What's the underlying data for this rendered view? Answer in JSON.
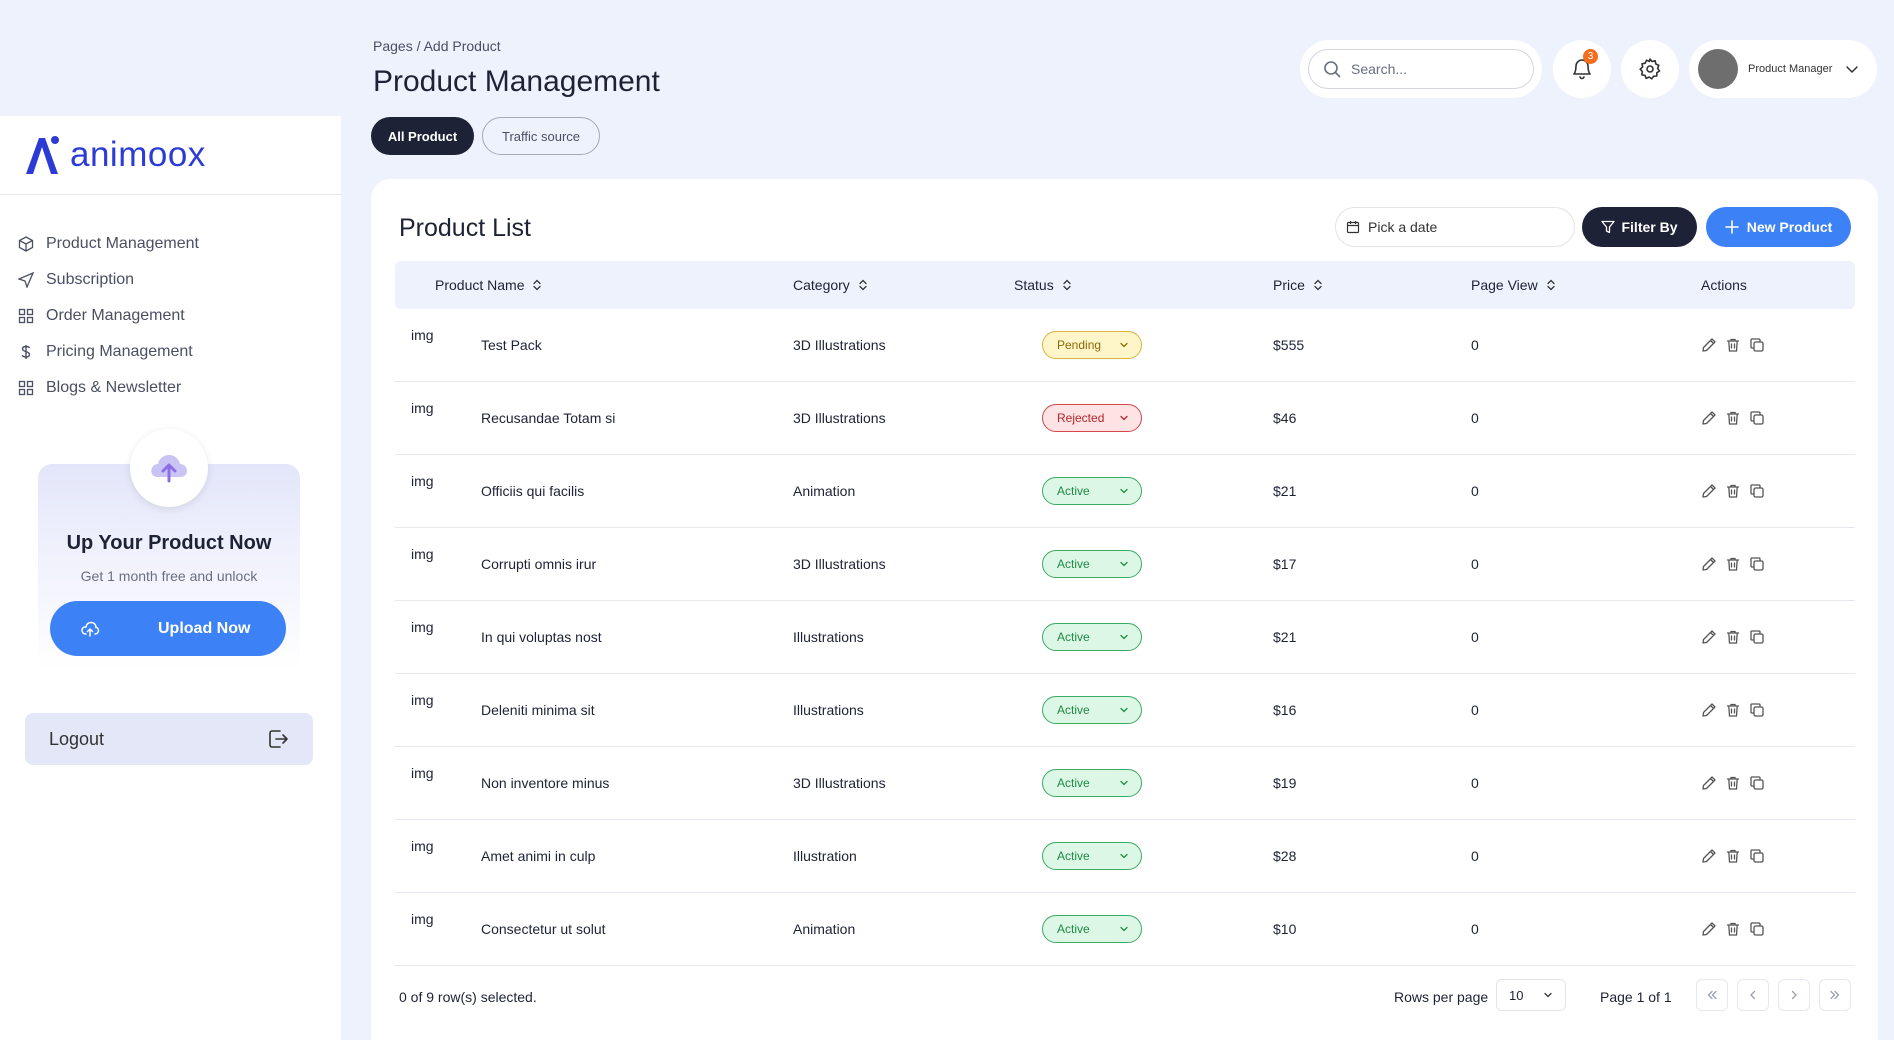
{
  "brand": {
    "name": "animoox",
    "color": "#2c3bd6"
  },
  "sidebar": {
    "items": [
      {
        "label": "Product Management",
        "icon": "box-icon"
      },
      {
        "label": "Subscription",
        "icon": "send-icon"
      },
      {
        "label": "Order Management",
        "icon": "grid-icon"
      },
      {
        "label": "Pricing Management",
        "icon": "dollar-icon"
      },
      {
        "label": "Blogs & Newsletter",
        "icon": "grid-icon"
      }
    ],
    "promo": {
      "title": "Up Your Product Now",
      "subtitle": "Get 1 month free and unlock",
      "button": "Upload Now"
    },
    "logout": "Logout"
  },
  "header": {
    "breadcrumb": "Pages / Add Product",
    "title": "Product Management",
    "tabs": [
      "All Product",
      "Traffic source"
    ],
    "search_placeholder": "Search...",
    "notifications": "3",
    "user": "Product Manager"
  },
  "card": {
    "title": "Product List",
    "date_placeholder": "Pick a date",
    "filter_label": "Filter By",
    "new_label": "New Product"
  },
  "table": {
    "columns": [
      "Product Name",
      "Category",
      "Status",
      "Price",
      "Page View",
      "Actions"
    ],
    "rows": [
      {
        "img": "img",
        "name": "Test Pack",
        "category": "3D Illustrations",
        "status": "Pending",
        "price": "$555",
        "views": "0"
      },
      {
        "img": "img",
        "name": "Recusandae Totam si",
        "category": "3D Illustrations",
        "status": "Rejected",
        "price": "$46",
        "views": "0"
      },
      {
        "img": "img",
        "name": "Officiis qui facilis",
        "category": "Animation",
        "status": "Active",
        "price": "$21",
        "views": "0"
      },
      {
        "img": "img",
        "name": "Corrupti omnis irur",
        "category": "3D Illustrations",
        "status": "Active",
        "price": "$17",
        "views": "0"
      },
      {
        "img": "img",
        "name": "In qui voluptas nost",
        "category": "Illustrations",
        "status": "Active",
        "price": "$21",
        "views": "0"
      },
      {
        "img": "img",
        "name": "Deleniti minima sit",
        "category": "Illustrations",
        "status": "Active",
        "price": "$16",
        "views": "0"
      },
      {
        "img": "img",
        "name": "Non inventore minus",
        "category": "3D Illustrations",
        "status": "Active",
        "price": "$19",
        "views": "0"
      },
      {
        "img": "img",
        "name": "Amet animi in culp",
        "category": "Illustration",
        "status": "Active",
        "price": "$28",
        "views": "0"
      },
      {
        "img": "img",
        "name": "Consectetur ut solut",
        "category": "Animation",
        "status": "Active",
        "price": "$10",
        "views": "0"
      }
    ]
  },
  "footer": {
    "selected": "0 of 9 row(s) selected.",
    "rows_per_page_label": "Rows per page",
    "rows_per_page": "10",
    "page_info": "Page 1 of 1"
  },
  "colors": {
    "primary": "#3c82f6",
    "dark": "#1d2236",
    "pending": "#d8b43a",
    "rejected": "#d3474d",
    "active": "#3caa63",
    "badge": "#f56e1e"
  }
}
